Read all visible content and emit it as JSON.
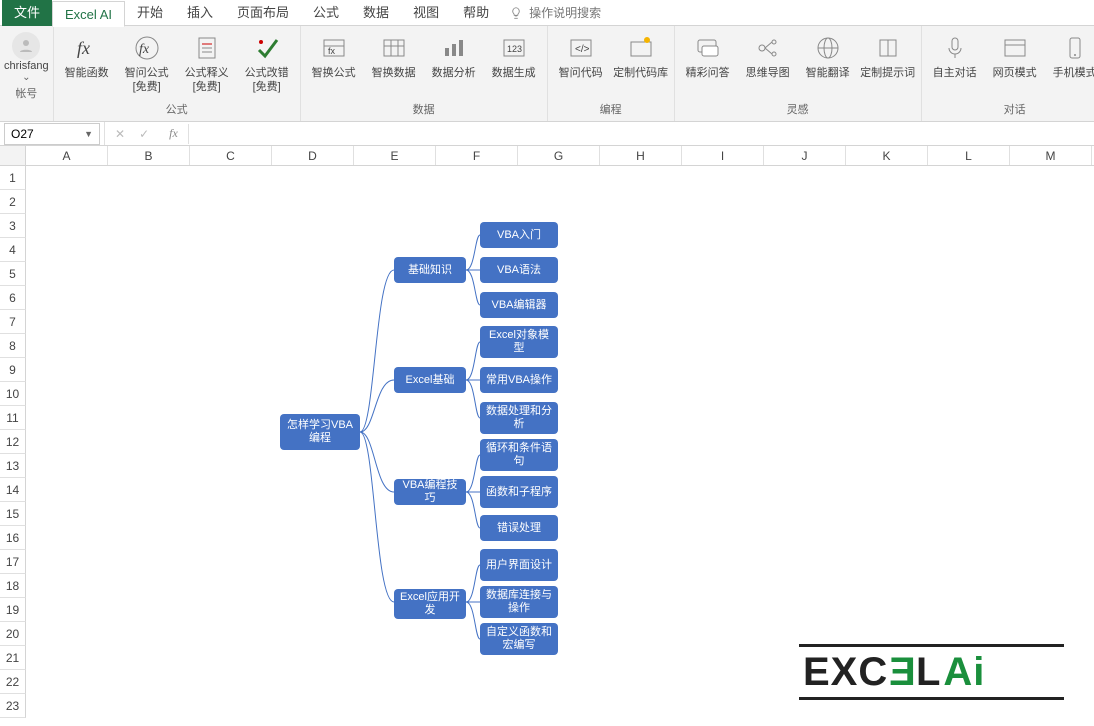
{
  "tabs": {
    "file": "文件",
    "excel_ai": "Excel AI",
    "start": "开始",
    "insert": "插入",
    "layout": "页面布局",
    "formula": "公式",
    "data": "数据",
    "view": "视图",
    "help": "帮助",
    "search": "操作说明搜索"
  },
  "account": {
    "name": "chrisfang",
    "label": "帐号"
  },
  "ribbon": {
    "formula_group": "公式",
    "data_group": "数据",
    "code_group": "编程",
    "inspire_group": "灵感",
    "chat_group": "对话",
    "btn_smartfn": "智能函数",
    "btn_askfml": "智问公式\n[免费]",
    "btn_fmlexp": "公式释义\n[免费]",
    "btn_fmlfix": "公式改错\n[免费]",
    "btn_swapfml": "智换公式",
    "btn_swapdata": "智换数据",
    "btn_analysis": "数据分析",
    "btn_gendata": "数据生成",
    "btn_askcode": "智问代码",
    "btn_codelib": "定制代码库",
    "btn_qa": "精彩问答",
    "btn_mind": "思维导图",
    "btn_trans": "智能翻译",
    "btn_prompt": "定制提示词",
    "btn_autochat": "自主对话",
    "btn_webmode": "网页模式",
    "btn_mobile": "手机模式"
  },
  "namebox": {
    "value": "O27"
  },
  "columns": [
    "A",
    "B",
    "C",
    "D",
    "E",
    "F",
    "G",
    "H",
    "I",
    "J",
    "K",
    "L",
    "M"
  ],
  "rows": [
    "1",
    "2",
    "3",
    "4",
    "5",
    "6",
    "7",
    "8",
    "9",
    "10",
    "11",
    "12",
    "13",
    "14",
    "15",
    "16",
    "17",
    "18",
    "19",
    "20",
    "21",
    "22",
    "23"
  ],
  "mindmap": {
    "root": "怎样学习VBA编程",
    "b1": "基础知识",
    "b2": "Excel基础",
    "b3": "VBA编程技巧",
    "b4": "Excel应用开发",
    "c1": "VBA入门",
    "c2": "VBA语法",
    "c3": "VBA编辑器",
    "c4": "Excel对象模型",
    "c5": "常用VBA操作",
    "c6": "数据处理和分析",
    "c7": "循环和条件语句",
    "c8": "函数和子程序",
    "c9": "错误处理",
    "c10": "用户界面设计",
    "c11": "数据库连接与操作",
    "c12": "自定义函数和宏编写"
  },
  "logo": {
    "t1": "EXC",
    "t2": "E",
    "t3": "L",
    "t4": "Ai"
  }
}
